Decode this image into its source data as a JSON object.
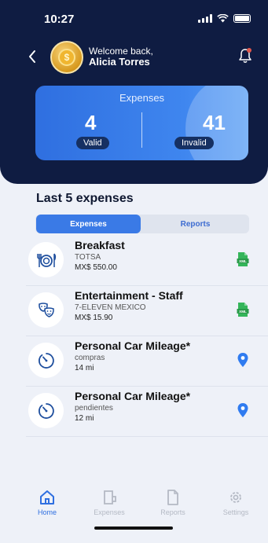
{
  "status_bar": {
    "time": "10:27"
  },
  "header": {
    "welcome": "Welcome back,",
    "user_name": "Alicia Torres"
  },
  "summary": {
    "title": "Expenses",
    "valid_count": "4",
    "valid_label": "Valid",
    "invalid_count": "41",
    "invalid_label": "Invalid"
  },
  "section": {
    "title": "Last 5 expenses"
  },
  "segments": {
    "expenses": "Expenses",
    "reports": "Reports",
    "selected": "Expenses"
  },
  "expenses": [
    {
      "title": "Breakfast",
      "merchant": "TOTSA",
      "amount": "MX$ 550.00",
      "icon": "dining-icon",
      "action_icon": "xml-file-icon"
    },
    {
      "title": "Entertainment - Staff",
      "merchant": "7-ELEVEN MEXICO",
      "amount": "MX$ 15.90",
      "icon": "masks-icon",
      "action_icon": "xml-file-icon"
    },
    {
      "title": "Personal Car Mileage*",
      "merchant": "compras",
      "amount": "14 mi",
      "icon": "speedometer-icon",
      "action_icon": "location-pin-icon"
    },
    {
      "title": "Personal Car Mileage*",
      "merchant": "pendientes",
      "amount": "12 mi",
      "icon": "speedometer-icon",
      "action_icon": "location-pin-icon"
    }
  ],
  "tabbar": {
    "home": "Home",
    "expenses": "Expenses",
    "reports": "Reports",
    "settings": "Settings",
    "active": "Home"
  },
  "colors": {
    "header_bg": "#0f1c42",
    "accent": "#2f6fe0",
    "xml_green": "#34b55a",
    "pin_blue": "#2f7bf0",
    "notification_dot": "#e0584d"
  }
}
